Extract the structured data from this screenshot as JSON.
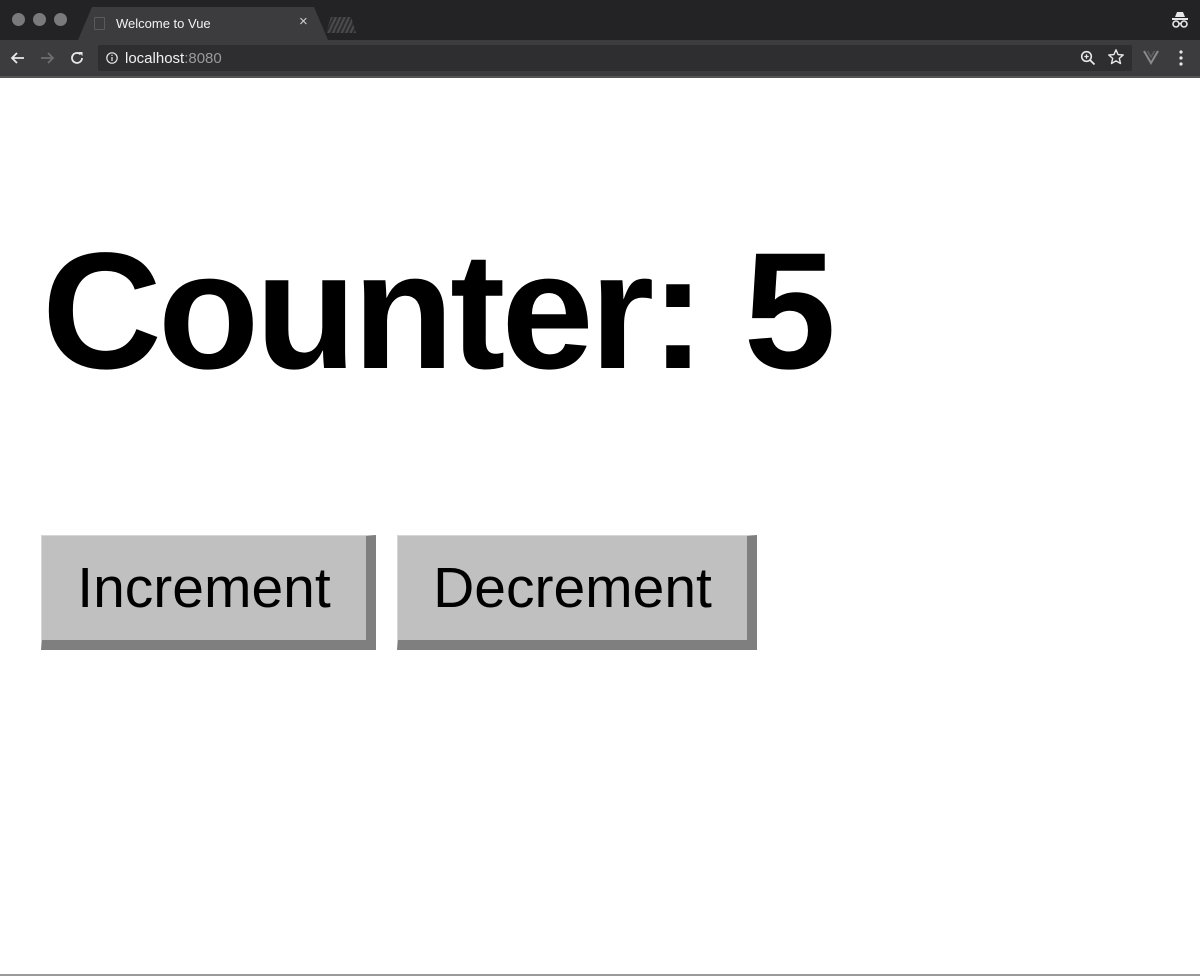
{
  "browser": {
    "tab": {
      "title": "Welcome to Vue",
      "close_glyph": "×"
    },
    "address_bar": {
      "host": "localhost",
      "port": ":8080"
    },
    "icons": {
      "incognito": "incognito-icon",
      "back": "back-arrow-icon",
      "forward": "forward-arrow-icon",
      "reload": "reload-icon",
      "info": "info-icon",
      "zoom": "zoom-icon",
      "bookmark": "star-icon",
      "extension": "vue-extension-icon",
      "menu": "menu-icon"
    },
    "colors": {
      "frame": "#232325",
      "toolbar": "#3c3c3e",
      "omnibox": "#2e2e30"
    }
  },
  "page": {
    "heading": "Counter: 5",
    "buttons": {
      "increment": "Increment",
      "decrement": "Decrement"
    },
    "colors": {
      "button_face": "#c0c0c0",
      "button_shadow": "#7f7f7f",
      "text": "#000000",
      "background": "#ffffff"
    }
  }
}
